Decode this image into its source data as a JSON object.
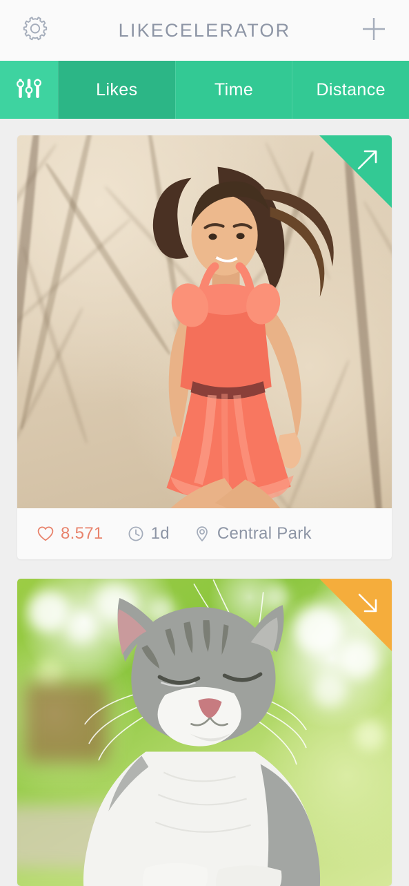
{
  "header": {
    "title": "LIKECELERATOR",
    "settings_icon": "gear-icon",
    "add_icon": "plus-icon"
  },
  "tabbar": {
    "filter_icon": "sliders-filter-icon",
    "tabs": [
      {
        "label": "Likes",
        "active": true
      },
      {
        "label": "Time",
        "active": false
      },
      {
        "label": "Distance",
        "active": false
      }
    ]
  },
  "colors": {
    "tab_bar_green": "#33c994",
    "tab_active_green": "#2cb686",
    "filter_cell_green": "#3ed3a0",
    "trend_up_green": "#33c994",
    "trend_down_orange": "#f5ad3c",
    "likes_salmon": "#e8836c",
    "muted_text": "#8d95a5",
    "page_background": "#efefef",
    "card_background": "#fafafa",
    "header_background": "#fafafa"
  },
  "feed": {
    "cards": [
      {
        "photo": "woman-jumping-in-coral-dress-bare-trees",
        "trend": {
          "direction": "up",
          "icon": "arrow-up-right-icon",
          "color": "#33c994"
        },
        "meta": {
          "likes": {
            "icon": "heart-icon",
            "value": "8.571"
          },
          "time": {
            "icon": "clock-icon",
            "value": "1d"
          },
          "location": {
            "icon": "map-pin-icon",
            "value": "Central Park"
          }
        }
      },
      {
        "photo": "grey-white-cat-squinting-green-bokeh",
        "trend": {
          "direction": "down",
          "icon": "arrow-down-right-icon",
          "color": "#f5ad3c"
        },
        "meta": null
      }
    ]
  }
}
